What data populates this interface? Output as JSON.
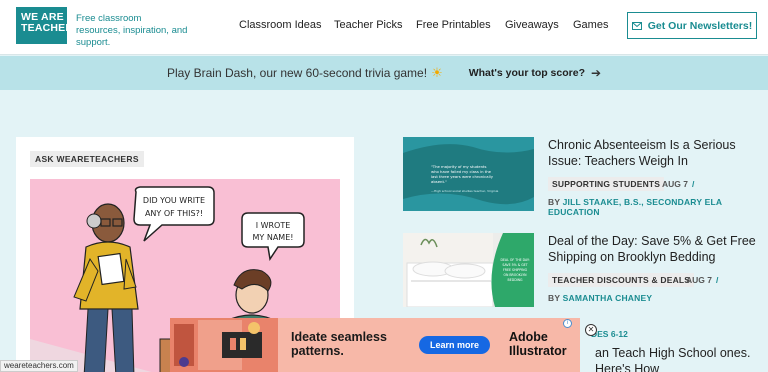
{
  "header": {
    "logo_line1": "WE ARE",
    "logo_line2": "TEACHERS",
    "tagline": "Free classroom resources, inspiration, and support.",
    "nav": [
      "Classroom Ideas",
      "Teacher Picks",
      "Free Printables",
      "Giveaways",
      "Games"
    ],
    "newsletter": "Get Our Newsletters!"
  },
  "banner": {
    "text": "Play Brain Dash, our new 60-second trivia game!",
    "cta": "What's your top score?"
  },
  "feature": {
    "badge": "ASK WEARETEACHERS",
    "bubble1": "DID YOU WRITE ANY OF THIS?!",
    "bubble2": "I WROTE MY NAME!"
  },
  "articles": [
    {
      "title": "Chronic Absenteeism Is a Serious Issue: Teachers Weigh In",
      "tag": "SUPPORTING STUDENTS",
      "date": "AUG 7",
      "by": "BY",
      "author": "JILL STAAKE, B.S., SECONDARY ELA EDUCATION",
      "thumb_quote": "\"The majority of my students who have failed my class in the last three years were chronically absent.\"",
      "thumb_cite": "—High school social studies teacher, Virginia"
    },
    {
      "title": "Deal of the Day: Save 5% & Get Free Shipping on Brooklyn Bedding",
      "tag": "TEACHER DISCOUNTS & DEALS",
      "date": "AUG 7",
      "by": "BY",
      "author": "SAMANTHA CHANEY",
      "thumb_text": "DEAL OF THE DAY: SAVE 5% & GET FREE SHIPPING ON BROOKLYN BEDDING"
    }
  ],
  "third_article": {
    "grades": "DES 6-12",
    "title": "an Teach High School ones. Here's How"
  },
  "ad": {
    "headline_line1": "Ideate seamless",
    "headline_line2": "patterns.",
    "button": "Learn more",
    "brand_line1": "Adobe",
    "brand_line2": "Illustrator"
  },
  "status_url": "weareteachers.com",
  "colors": {
    "brand_teal": "#1a8c91",
    "banner_bg": "#b8e2e8",
    "page_bg": "#e3f3f6"
  }
}
